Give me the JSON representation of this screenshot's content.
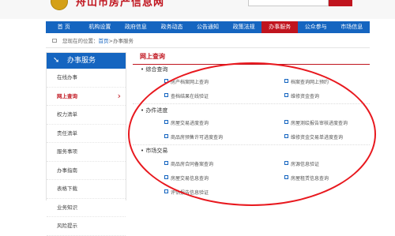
{
  "header": {
    "logo_text": "舟山市房产信息网"
  },
  "nav": {
    "items": [
      {
        "label": "首 页",
        "active": false
      },
      {
        "label": "机构设置",
        "active": false
      },
      {
        "label": "政府信息",
        "active": false
      },
      {
        "label": "政务动态",
        "active": false
      },
      {
        "label": "公告通知",
        "active": false
      },
      {
        "label": "政策法规",
        "active": false
      },
      {
        "label": "办事服务",
        "active": true
      },
      {
        "label": "公众参与",
        "active": false
      },
      {
        "label": "市场信息",
        "active": false
      }
    ]
  },
  "breadcrumb": {
    "prefix": "您现在的位置：",
    "home": "首页",
    "separator": ">",
    "current": "办事服务"
  },
  "sidebar": {
    "title": "办事服务",
    "items": [
      {
        "label": "在线办事",
        "active": false
      },
      {
        "label": "网上查询",
        "active": true
      },
      {
        "label": "权力清单",
        "active": false
      },
      {
        "label": "责任清单",
        "active": false
      },
      {
        "label": "服务事项",
        "active": false
      },
      {
        "label": "办事指南",
        "active": false
      },
      {
        "label": "表格下载",
        "active": false
      },
      {
        "label": "业务知识",
        "active": false
      },
      {
        "label": "风险提示",
        "active": false
      }
    ]
  },
  "main": {
    "title": "网上查询",
    "sections": [
      {
        "title": "综合查询",
        "links": [
          "房产档案网上查询",
          "档案查询网上预约",
          "查档结果在线验证",
          "维修资金查询"
        ]
      },
      {
        "title": "办件进度",
        "links": [
          "房屋交易进度查询",
          "房屋测绘报告审核进度查询",
          "商品房预售许可进度查询",
          "维修资金交易单进度查询"
        ]
      },
      {
        "title": "市场交易",
        "links": [
          "商品房合同备案查询",
          "房源信息验证",
          "房屋交易信息查询",
          "房屋租赁信息查询",
          "评估报告信息验证"
        ]
      }
    ]
  },
  "colors": {
    "nav_blue": "#1565c0",
    "accent_red": "#c0141e",
    "annotation_red": "#e8181e"
  }
}
